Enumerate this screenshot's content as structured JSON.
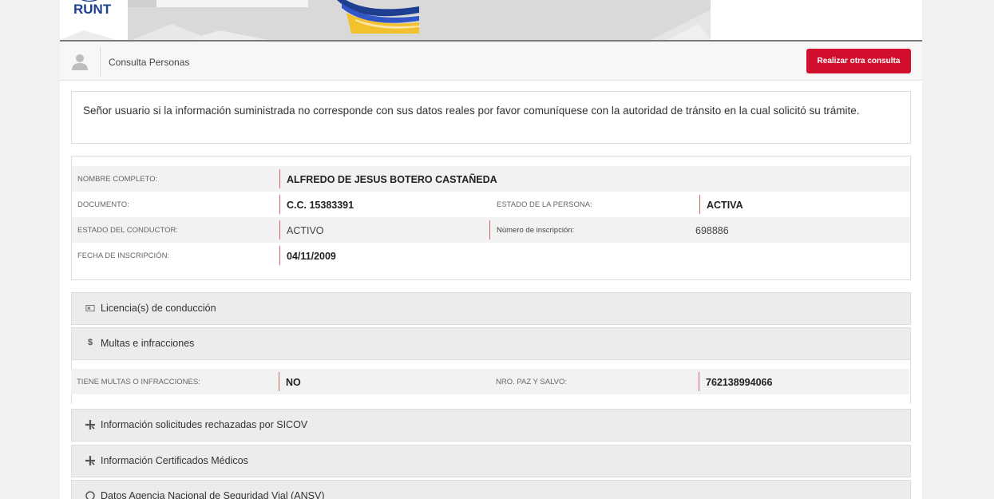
{
  "header": {
    "logo_text": "RUNT",
    "colors": {
      "brand_blue": "#1e3f8f",
      "accent_yellow": "#f2c12e",
      "button_red": "#d2102d"
    }
  },
  "consulta": {
    "title": "Consulta Personas",
    "button_label": "Realizar otra consulta",
    "icon": "person-icon"
  },
  "notice": {
    "text": "Señor usuario si la información suministrada no corresponde con sus datos reales por favor comuníquese con la autoridad de tránsito en la cual solicitó su trámite."
  },
  "person": {
    "nombre_label": "NOMBRE COMPLETO:",
    "nombre_value": "ALFREDO DE JESUS BOTERO CASTAÑEDA",
    "documento_label": "DOCUMENTO:",
    "documento_value": "C.C. 15383391",
    "estado_persona_label": "ESTADO DE LA PERSONA:",
    "estado_persona_value": "ACTIVA",
    "estado_conductor_label": "ESTADO DEL CONDUCTOR:",
    "estado_conductor_value": "ACTIVO",
    "inscripcion_num_label": "Número de inscripción:",
    "inscripcion_num_value": "698886",
    "fecha_label": "FECHA DE INSCRIPCIÓN:",
    "fecha_value": "04/11/2009"
  },
  "sections": {
    "licencias": {
      "label": "Licencia(s) de conducción",
      "icon": "id-card-icon"
    },
    "multas": {
      "label": "Multas e infracciones",
      "icon": "dollar-icon",
      "glyph": "$"
    },
    "sicov": {
      "label": "Información solicitudes rechazadas por SICOV",
      "icon": "plus-medical-icon"
    },
    "medicos": {
      "label": "Información Certificados Médicos",
      "icon": "plus-medical-icon"
    },
    "ansv": {
      "label": "Datos Agencia Nacional de Seguridad Vial (ANSV)",
      "icon": "circle-icon"
    }
  },
  "multas_detail": {
    "tiene_label": "TIENE MULTAS O INFRACCIONES:",
    "tiene_value": "NO",
    "paz_label": "NRO. PAZ Y SALVO:",
    "paz_value": "762138994066"
  }
}
